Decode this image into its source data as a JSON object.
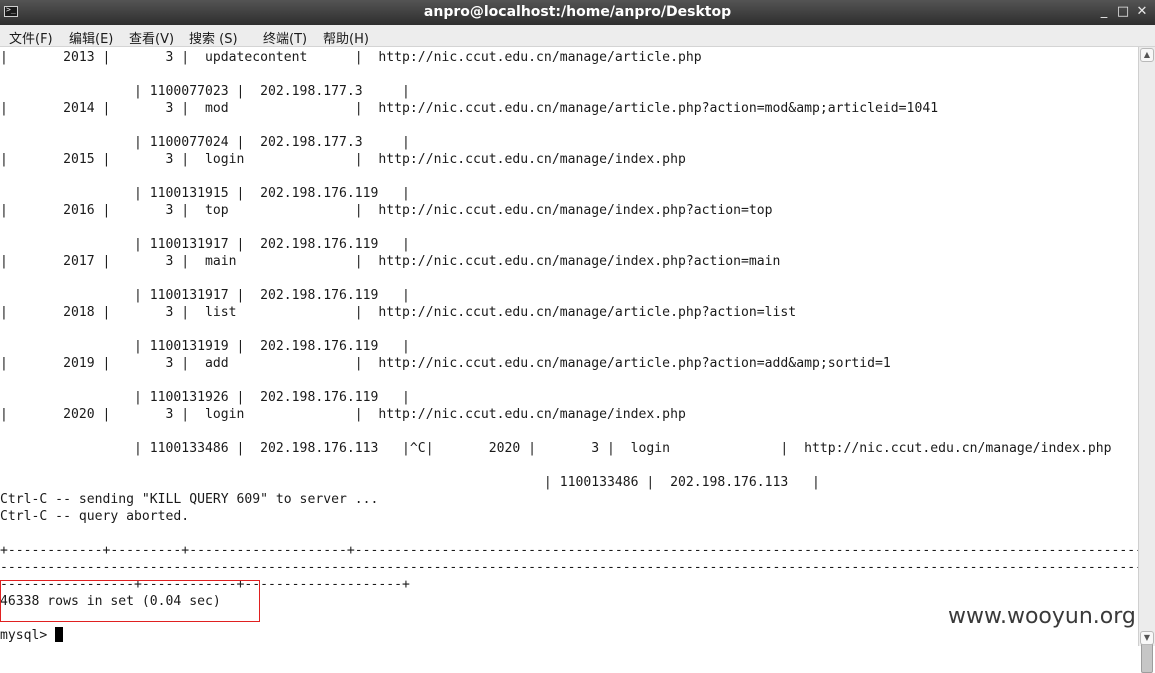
{
  "window": {
    "title": "anpro@localhost:/home/anpro/Desktop",
    "icon": "terminal-icon",
    "minimize_label": "_",
    "maximize_label": "□",
    "close_label": "✕"
  },
  "menu": [
    {
      "label": "文件(F)"
    },
    {
      "label": "编辑(E)"
    },
    {
      "label": "查看(V)"
    },
    {
      "label": "搜索 (S)"
    },
    {
      "label": "终端(T)"
    },
    {
      "label": "帮助(H)"
    }
  ],
  "terminal": {
    "lines": [
      "|       2013 |       3 |  updatecontent      |  http://nic.ccut.edu.cn/manage/article.php",
      "",
      "                 | 1100077023 |  202.198.177.3     |",
      "|       2014 |       3 |  mod                |  http://nic.ccut.edu.cn/manage/article.php?action=mod&amp;articleid=1041",
      "",
      "                 | 1100077024 |  202.198.177.3     |",
      "|       2015 |       3 |  login              |  http://nic.ccut.edu.cn/manage/index.php",
      "",
      "                 | 1100131915 |  202.198.176.119   |",
      "|       2016 |       3 |  top                |  http://nic.ccut.edu.cn/manage/index.php?action=top",
      "",
      "                 | 1100131917 |  202.198.176.119   |",
      "|       2017 |       3 |  main               |  http://nic.ccut.edu.cn/manage/index.php?action=main",
      "",
      "                 | 1100131917 |  202.198.176.119   |",
      "|       2018 |       3 |  list               |  http://nic.ccut.edu.cn/manage/article.php?action=list",
      "",
      "                 | 1100131919 |  202.198.176.119   |",
      "|       2019 |       3 |  add                |  http://nic.ccut.edu.cn/manage/article.php?action=add&amp;sortid=1",
      "",
      "                 | 1100131926 |  202.198.176.119   |",
      "|       2020 |       3 |  login              |  http://nic.ccut.edu.cn/manage/index.php",
      "",
      "                 | 1100133486 |  202.198.176.113   |^C|       2020 |       3 |  login              |  http://nic.ccut.edu.cn/manage/index.php",
      "",
      "                                                                     | 1100133486 |  202.198.176.113   |",
      "Ctrl-C -- sending \"KILL QUERY 609\" to server ...",
      "Ctrl-C -- query aborted.",
      "",
      "+------------+---------+--------------------+--------------------------------------------------------------------------------------------------------------------------------------------",
      "------------------------------------------------------------------------------------------------------------------------------------------------------------------------------------",
      "-----------------+------------+--------------------+",
      "46338 rows in set (0.04 sec)",
      "",
      "mysql> "
    ]
  },
  "scrollbar": {
    "up_icon": "arrow-up-icon",
    "down_icon": "arrow-down-icon"
  },
  "watermark": "www.wooyun.org"
}
